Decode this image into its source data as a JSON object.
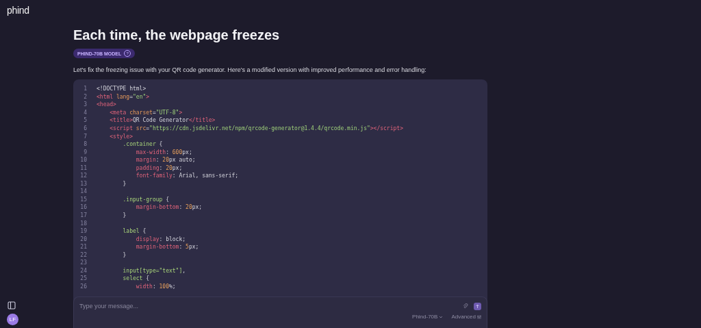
{
  "logo": "phind",
  "title": "Each time, the webpage freezes",
  "model_badge": {
    "label": "PHIND-70B MODEL",
    "help": "?"
  },
  "intro": "Let's fix the freezing issue with your QR code generator. Here's a modified version with improved performance and error handling:",
  "code": [
    {
      "number": "1",
      "tokens": [
        {
          "kind": "plain",
          "text": "<!DOCTYPE html>"
        }
      ]
    },
    {
      "number": "2",
      "tokens": [
        {
          "kind": "tag",
          "text": "<html "
        },
        {
          "kind": "attr",
          "text": "lang"
        },
        {
          "kind": "plain",
          "text": "="
        },
        {
          "kind": "string",
          "text": "\"en\""
        },
        {
          "kind": "tag",
          "text": ">"
        }
      ]
    },
    {
      "number": "3",
      "tokens": [
        {
          "kind": "tag",
          "text": "<head>"
        }
      ]
    },
    {
      "number": "4",
      "tokens": [
        {
          "kind": "tag",
          "text": "    <meta "
        },
        {
          "kind": "attr",
          "text": "charset"
        },
        {
          "kind": "plain",
          "text": "="
        },
        {
          "kind": "string",
          "text": "\"UTF-8\""
        },
        {
          "kind": "tag",
          "text": ">"
        }
      ]
    },
    {
      "number": "5",
      "tokens": [
        {
          "kind": "tag",
          "text": "    <title>"
        },
        {
          "kind": "plain",
          "text": "QR Code Generator"
        },
        {
          "kind": "tag",
          "text": "</title>"
        }
      ]
    },
    {
      "number": "6",
      "tokens": [
        {
          "kind": "tag",
          "text": "    <script "
        },
        {
          "kind": "attr",
          "text": "src"
        },
        {
          "kind": "plain",
          "text": "="
        },
        {
          "kind": "string",
          "text": "\"https://cdn.jsdelivr.net/npm/qrcode-generator@1.4.4/qrcode.min.js\""
        },
        {
          "kind": "tag",
          "text": "></script>"
        }
      ]
    },
    {
      "number": "7",
      "tokens": [
        {
          "kind": "tag",
          "text": "    <style>"
        }
      ]
    },
    {
      "number": "8",
      "tokens": [
        {
          "kind": "selector",
          "text": "        .container"
        },
        {
          "kind": "plain",
          "text": " {"
        }
      ]
    },
    {
      "number": "9",
      "tokens": [
        {
          "kind": "prop",
          "text": "            max-width"
        },
        {
          "kind": "plain",
          "text": ": "
        },
        {
          "kind": "num",
          "text": "600"
        },
        {
          "kind": "plain",
          "text": "px;"
        }
      ]
    },
    {
      "number": "10",
      "tokens": [
        {
          "kind": "prop",
          "text": "            margin"
        },
        {
          "kind": "plain",
          "text": ": "
        },
        {
          "kind": "num",
          "text": "20"
        },
        {
          "kind": "plain",
          "text": "px auto;"
        }
      ]
    },
    {
      "number": "11",
      "tokens": [
        {
          "kind": "prop",
          "text": "            padding"
        },
        {
          "kind": "plain",
          "text": ": "
        },
        {
          "kind": "num",
          "text": "20"
        },
        {
          "kind": "plain",
          "text": "px;"
        }
      ]
    },
    {
      "number": "12",
      "tokens": [
        {
          "kind": "prop",
          "text": "            font-family"
        },
        {
          "kind": "plain",
          "text": ": Arial, sans-serif;"
        }
      ]
    },
    {
      "number": "13",
      "tokens": [
        {
          "kind": "plain",
          "text": "        }"
        }
      ]
    },
    {
      "number": "14"
    },
    {
      "number": "15",
      "tokens": [
        {
          "kind": "selector",
          "text": "        .input-group"
        },
        {
          "kind": "plain",
          "text": " {"
        }
      ]
    },
    {
      "number": "16",
      "tokens": [
        {
          "kind": "prop",
          "text": "            margin-bottom"
        },
        {
          "kind": "plain",
          "text": ": "
        },
        {
          "kind": "num",
          "text": "20"
        },
        {
          "kind": "plain",
          "text": "px;"
        }
      ]
    },
    {
      "number": "17",
      "tokens": [
        {
          "kind": "plain",
          "text": "        }"
        }
      ]
    },
    {
      "number": "18"
    },
    {
      "number": "19",
      "tokens": [
        {
          "kind": "selector",
          "text": "        label"
        },
        {
          "kind": "plain",
          "text": " {"
        }
      ]
    },
    {
      "number": "20",
      "tokens": [
        {
          "kind": "prop",
          "text": "            display"
        },
        {
          "kind": "plain",
          "text": ": block;"
        }
      ]
    },
    {
      "number": "21",
      "tokens": [
        {
          "kind": "prop",
          "text": "            margin-bottom"
        },
        {
          "kind": "plain",
          "text": ": "
        },
        {
          "kind": "num",
          "text": "5"
        },
        {
          "kind": "plain",
          "text": "px;"
        }
      ]
    },
    {
      "number": "22",
      "tokens": [
        {
          "kind": "plain",
          "text": "        }"
        }
      ]
    },
    {
      "number": "23"
    },
    {
      "number": "24",
      "tokens": [
        {
          "kind": "selector",
          "text": "        input[type=\"text\"]"
        },
        {
          "kind": "plain",
          "text": ","
        }
      ]
    },
    {
      "number": "25",
      "tokens": [
        {
          "kind": "selector",
          "text": "        select"
        },
        {
          "kind": "plain",
          "text": " {"
        }
      ]
    },
    {
      "number": "26",
      "tokens": [
        {
          "kind": "prop",
          "text": "            width"
        },
        {
          "kind": "plain",
          "text": ": "
        },
        {
          "kind": "num",
          "text": "100"
        },
        {
          "kind": "plain",
          "text": "%;"
        }
      ]
    }
  ],
  "composer": {
    "placeholder": "Type your message...",
    "model": "Phind-70B",
    "advanced": "Advanced"
  },
  "user": {
    "initials": "LF"
  }
}
